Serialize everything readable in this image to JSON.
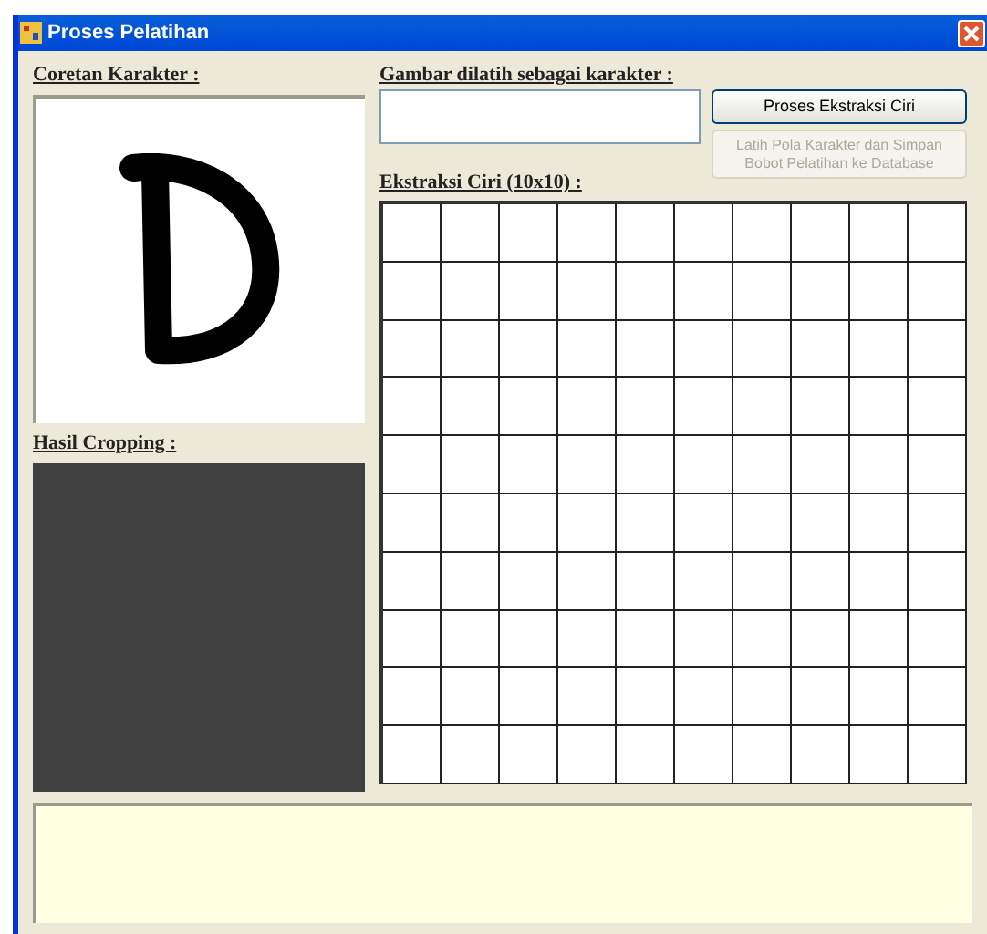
{
  "window": {
    "title": "Proses Pelatihan"
  },
  "drawing_panel": {
    "label": "Coretan Karakter :"
  },
  "cropping_panel": {
    "label": "Hasil Cropping :"
  },
  "target": {
    "label": "Gambar dilatih sebagai karakter :"
  },
  "buttons": [
    {
      "label": "Proses Ekstraksi Ciri",
      "disabled": false
    },
    {
      "label": "Latih Pola Karakter dan Simpan Bobot Pelatihan ke Database",
      "disabled": true
    }
  ],
  "feature_grid": {
    "label": "Ekstraksi Ciri (10x10) :"
  }
}
